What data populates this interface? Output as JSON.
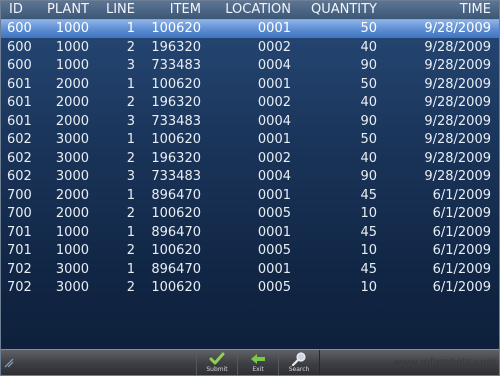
{
  "table": {
    "headers": {
      "id": "ID",
      "plant": "PLANT",
      "line": "LINE",
      "item": "ITEM",
      "location": "LOCATION",
      "quantity": "QUANTITY",
      "time": "TIME"
    },
    "rows": [
      {
        "id": "600",
        "plant": "1000",
        "line": "1",
        "item": "100620",
        "location": "0001",
        "quantity": "50",
        "time": "9/28/2009",
        "selected": true
      },
      {
        "id": "600",
        "plant": "1000",
        "line": "2",
        "item": "196320",
        "location": "0002",
        "quantity": "40",
        "time": "9/28/2009"
      },
      {
        "id": "600",
        "plant": "1000",
        "line": "3",
        "item": "733483",
        "location": "0004",
        "quantity": "90",
        "time": "9/28/2009"
      },
      {
        "id": "601",
        "plant": "2000",
        "line": "1",
        "item": "100620",
        "location": "0001",
        "quantity": "50",
        "time": "9/28/2009"
      },
      {
        "id": "601",
        "plant": "2000",
        "line": "2",
        "item": "196320",
        "location": "0002",
        "quantity": "40",
        "time": "9/28/2009"
      },
      {
        "id": "601",
        "plant": "2000",
        "line": "3",
        "item": "733483",
        "location": "0004",
        "quantity": "90",
        "time": "9/28/2009"
      },
      {
        "id": "602",
        "plant": "3000",
        "line": "1",
        "item": "100620",
        "location": "0001",
        "quantity": "50",
        "time": "9/28/2009"
      },
      {
        "id": "602",
        "plant": "3000",
        "line": "2",
        "item": "196320",
        "location": "0002",
        "quantity": "40",
        "time": "9/28/2009"
      },
      {
        "id": "602",
        "plant": "3000",
        "line": "3",
        "item": "733483",
        "location": "0004",
        "quantity": "90",
        "time": "9/28/2009"
      },
      {
        "id": "700",
        "plant": "2000",
        "line": "1",
        "item": "896470",
        "location": "0001",
        "quantity": "45",
        "time": "6/1/2009"
      },
      {
        "id": "700",
        "plant": "2000",
        "line": "2",
        "item": "100620",
        "location": "0005",
        "quantity": "10",
        "time": "6/1/2009"
      },
      {
        "id": "701",
        "plant": "1000",
        "line": "1",
        "item": "896470",
        "location": "0001",
        "quantity": "45",
        "time": "6/1/2009"
      },
      {
        "id": "701",
        "plant": "1000",
        "line": "2",
        "item": "100620",
        "location": "0005",
        "quantity": "10",
        "time": "6/1/2009"
      },
      {
        "id": "702",
        "plant": "3000",
        "line": "1",
        "item": "896470",
        "location": "0001",
        "quantity": "45",
        "time": "6/1/2009"
      },
      {
        "id": "702",
        "plant": "3000",
        "line": "2",
        "item": "100620",
        "location": "0005",
        "quantity": "10",
        "time": "6/1/2009"
      }
    ]
  },
  "toolbar": {
    "submit": {
      "label": "Submit",
      "icon": "checkmark-icon"
    },
    "exit": {
      "label": "Exit",
      "icon": "arrow-left-icon"
    },
    "search": {
      "label": "Search",
      "icon": "magnifier-icon"
    }
  },
  "watermark": "www.mfgrobots.com",
  "colors": {
    "selected_row": "#5f8fd4",
    "background_top": "#274a78",
    "background_bottom": "#0d1e38",
    "checkmark": "#8fd14f",
    "exit_arrow": "#7ac943"
  }
}
